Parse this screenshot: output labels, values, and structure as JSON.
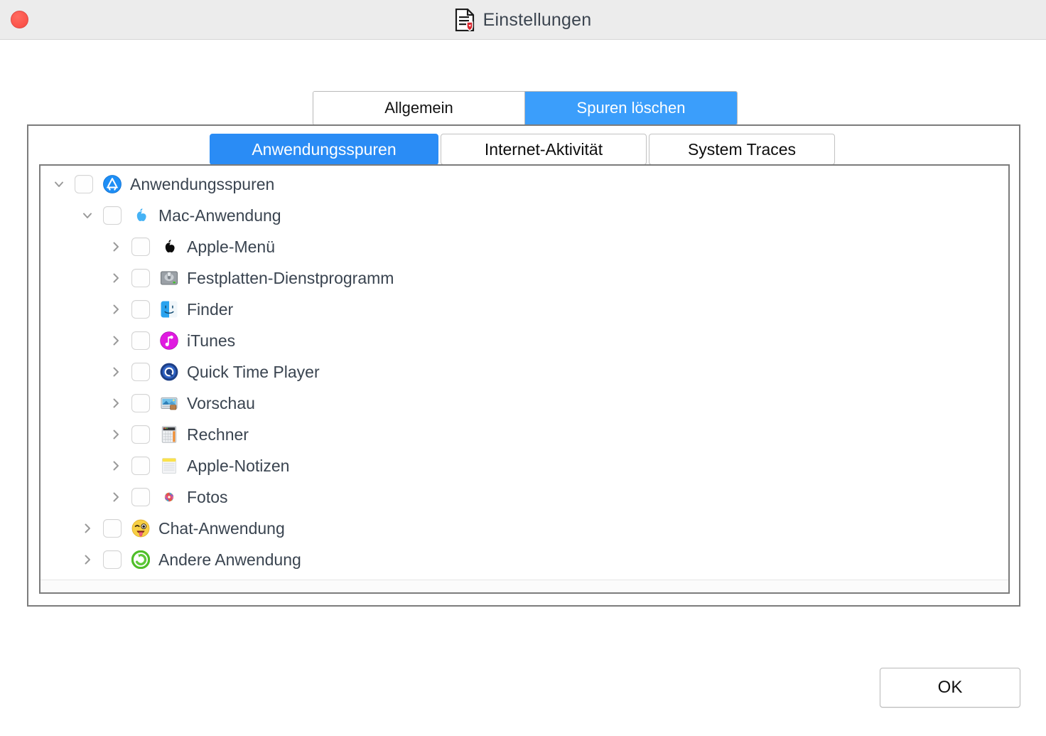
{
  "window": {
    "title": "Einstellungen",
    "title_icon": "document-shield-icon",
    "close_button": "close-window-button"
  },
  "outer_tabs": {
    "selected": "Spuren löschen",
    "items": [
      {
        "label": "Allgemein",
        "active": false
      },
      {
        "label": "Spuren löschen",
        "active": true
      }
    ]
  },
  "inner_tabs": {
    "selected": "Anwendungsspuren",
    "items": [
      {
        "label": "Anwendungsspuren",
        "active": true
      },
      {
        "label": "Internet-Aktivität",
        "active": false
      },
      {
        "label": "System Traces",
        "active": false
      }
    ]
  },
  "tree": {
    "rows": [
      {
        "label": "Anwendungsspuren",
        "level": 0,
        "twisty": "expanded",
        "checked": false,
        "icon": "app-store-icon"
      },
      {
        "label": "Mac-Anwendung",
        "level": 1,
        "twisty": "expanded",
        "checked": false,
        "icon": "apple-blue-icon"
      },
      {
        "label": "Apple-Menü",
        "level": 2,
        "twisty": "collapsed",
        "checked": false,
        "icon": "apple-black-icon"
      },
      {
        "label": "Festplatten-Dienstprogramm",
        "level": 2,
        "twisty": "collapsed",
        "checked": false,
        "icon": "disk-utility-icon"
      },
      {
        "label": "Finder",
        "level": 2,
        "twisty": "collapsed",
        "checked": false,
        "icon": "finder-icon"
      },
      {
        "label": "iTunes",
        "level": 2,
        "twisty": "collapsed",
        "checked": false,
        "icon": "itunes-icon"
      },
      {
        "label": "Quick Time Player",
        "level": 2,
        "twisty": "collapsed",
        "checked": false,
        "icon": "quicktime-icon"
      },
      {
        "label": "Vorschau",
        "level": 2,
        "twisty": "collapsed",
        "checked": false,
        "icon": "preview-icon"
      },
      {
        "label": "Rechner",
        "level": 2,
        "twisty": "collapsed",
        "checked": false,
        "icon": "calculator-icon"
      },
      {
        "label": "Apple-Notizen",
        "level": 2,
        "twisty": "collapsed",
        "checked": false,
        "icon": "notes-icon"
      },
      {
        "label": "Fotos",
        "level": 2,
        "twisty": "collapsed",
        "checked": false,
        "icon": "photos-icon"
      },
      {
        "label": "Chat-Anwendung",
        "level": 1,
        "twisty": "collapsed",
        "checked": false,
        "icon": "emoji-tongue-icon"
      },
      {
        "label": "Andere Anwendung",
        "level": 1,
        "twisty": "collapsed",
        "checked": false,
        "icon": "other-app-green-icon"
      }
    ]
  },
  "footer": {
    "ok_label": "OK"
  },
  "colors": {
    "accent_blue": "#3b9efb",
    "tab_blue": "#2a8cf5",
    "titlebar_bg": "#ececec",
    "close_red": "#fb534a",
    "text": "#3a4450",
    "border": "#7c7c7c"
  }
}
